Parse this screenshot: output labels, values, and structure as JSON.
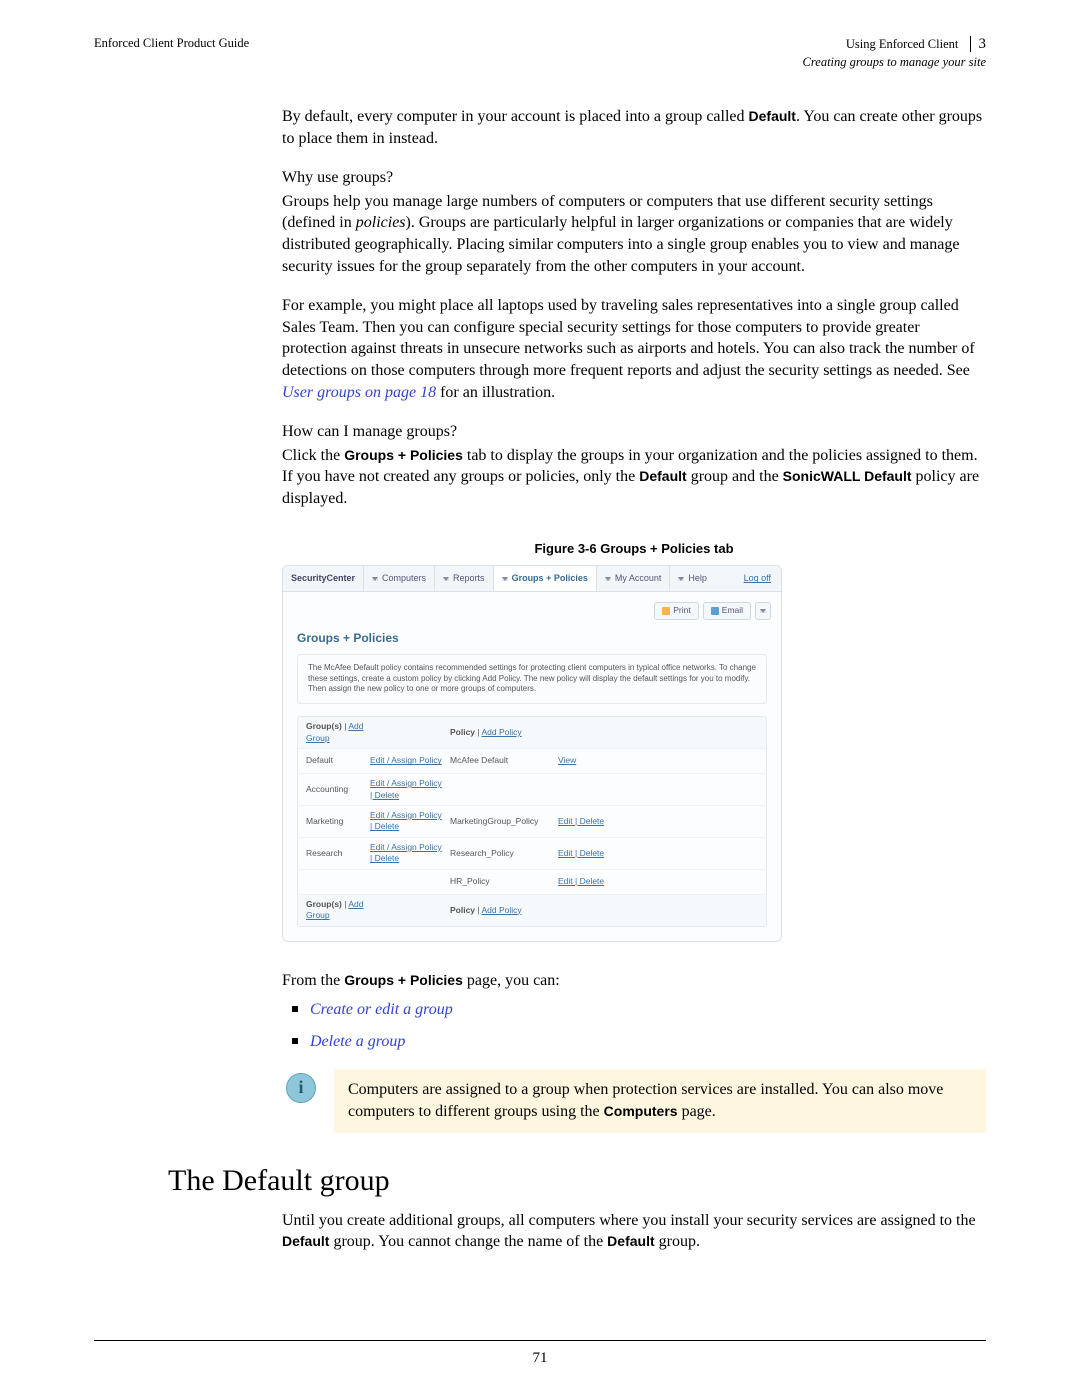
{
  "header": {
    "left": "Enforced Client Product Guide",
    "right_main": "Using Enforced Client",
    "right_chapter": "3",
    "right_sub": "Creating groups to manage your site"
  },
  "body": {
    "p1a": "By default, every computer in your account is placed into a group called ",
    "p1b": "Default",
    "p1c": ". You can create other groups to place them in instead.",
    "q1": "Why use groups?",
    "p2a": "Groups help you manage large numbers of computers or computers that use different security settings (defined in ",
    "p2b": "policies",
    "p2c": "). Groups are particularly helpful in larger organizations or companies that are widely distributed geographically. Placing similar computers into a single group enables you to view and manage security issues for the group separately from the other computers in your account.",
    "p3a": "For example, you might place all laptops used by traveling sales representatives into a single group called Sales Team. Then you can configure special security settings for those computers to provide greater protection against threats in unsecure networks such as airports and hotels. You can also track the number of detections on those computers through more frequent reports and adjust the security settings as needed. See ",
    "p3_link": "User groups",
    "p3_link2": " on page 18",
    "p3b": " for an illustration.",
    "q2": "How can I manage groups?",
    "p4a": "Click the ",
    "p4b": "Groups + Policies",
    "p4c": " tab to display the groups in your organization and the policies assigned to them. If you have not created any groups or policies, only the ",
    "p4d": "Default",
    "p4e": " group and the ",
    "p4f": "SonicWALL Default",
    "p4g": " policy are displayed.",
    "figcap": "Figure 3-6  Groups + Policies tab",
    "p5a": "From the ",
    "p5b": "Groups + Policies",
    "p5c": " page, you can:",
    "bullets": [
      "Create or edit a group",
      "Delete a group"
    ],
    "note_a": "Computers are assigned to a group when protection services are installed. You can also move computers to different groups using the ",
    "note_b": "Computers",
    "note_c": " page.",
    "h1": "The Default group",
    "p6a": "Until you create additional groups, all computers where you install your security services are assigned to the ",
    "p6b": "Default",
    "p6c": " group. You cannot change the name of the ",
    "p6d": "Default",
    "p6e": " group."
  },
  "figure": {
    "tabs": {
      "home": "SecurityCenter",
      "computers": "Computers",
      "reports": "Reports",
      "active": "Groups + Policies",
      "account": "My Account",
      "help": "Help",
      "logoff": "Log off"
    },
    "toolbar": {
      "print": "Print",
      "email": "Email"
    },
    "title": "Groups + Policies",
    "desc": "The McAfee Default policy contains recommended settings for protecting client computers in typical office networks. To change these settings, create a custom policy by clicking Add Policy. The new policy will display the default settings for you to modify. Then assign the new policy to one or more groups of computers.",
    "header1": "Group(s)",
    "add_group": "Add Group",
    "header2": "Policy",
    "add_policy": "Add Policy",
    "rows": [
      {
        "g": "Default",
        "ga": "Edit / Assign Policy",
        "p": "McAfee Default",
        "pa": "View"
      },
      {
        "g": "Accounting",
        "ga": "Edit / Assign Policy | Delete",
        "p": "",
        "pa": ""
      },
      {
        "g": "Marketing",
        "ga": "Edit / Assign Policy | Delete",
        "p": "MarketingGroup_Policy",
        "pa": "Edit | Delete"
      },
      {
        "g": "Research",
        "ga": "Edit / Assign Policy | Delete",
        "p": "Research_Policy",
        "pa": "Edit | Delete"
      },
      {
        "g": "",
        "ga": "",
        "p": "HR_Policy",
        "pa": "Edit | Delete"
      }
    ]
  },
  "page_number": "71"
}
